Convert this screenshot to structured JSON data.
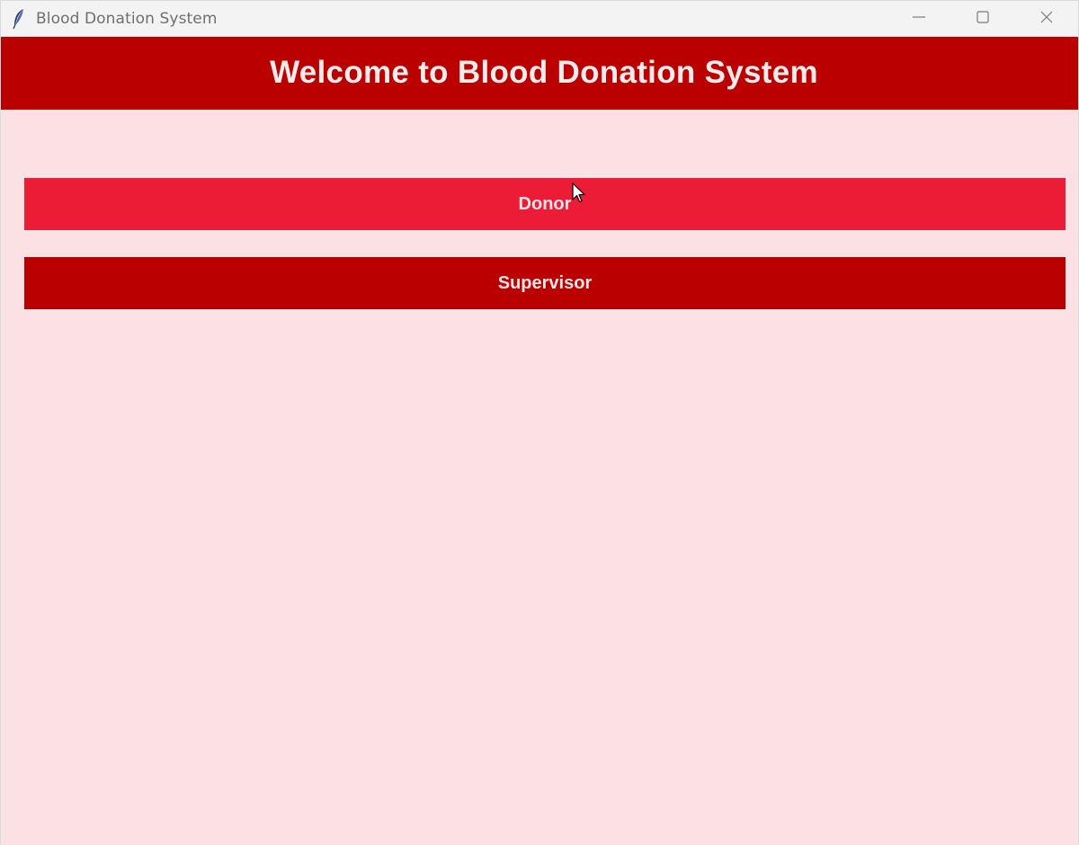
{
  "window": {
    "title": "Blood Donation System",
    "app_icon": "feather-icon",
    "controls": [
      "minimize-icon",
      "maximize-icon",
      "close-icon"
    ]
  },
  "header": {
    "title": "Welcome to Blood Donation System"
  },
  "buttons": {
    "donor": "Donor",
    "supervisor": "Supervisor"
  },
  "colors": {
    "header_bg": "#bb0000",
    "donor_bg": "#ed1c36",
    "supervisor_bg": "#bb0000",
    "page_bg": "#fbe1e3",
    "button_text": "#f8e6e8"
  }
}
